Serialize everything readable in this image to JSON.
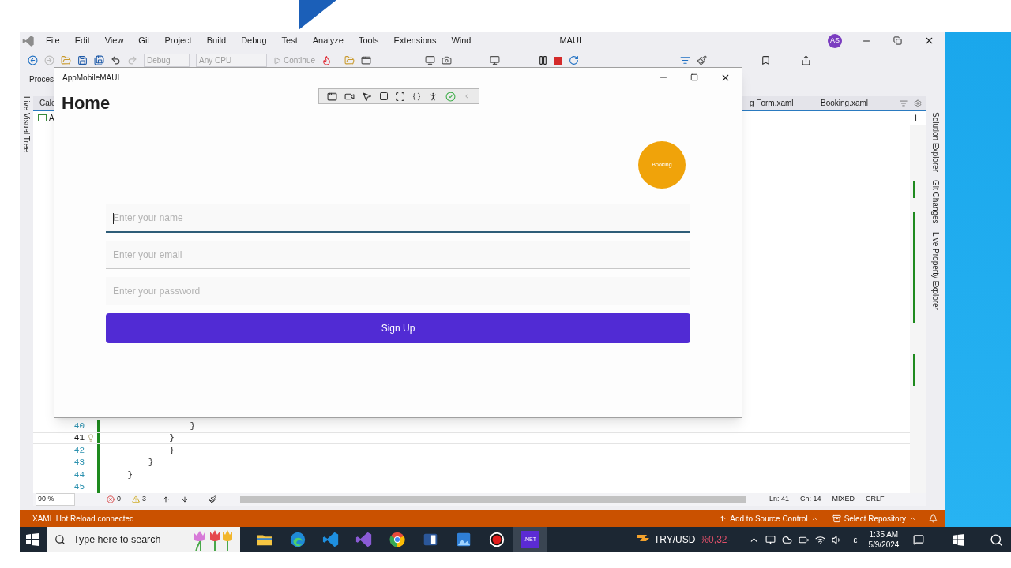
{
  "ide": {
    "menu": [
      "File",
      "Edit",
      "View",
      "Git",
      "Project",
      "Build",
      "Debug",
      "Test",
      "Analyze",
      "Tools",
      "Extensions",
      "Wind"
    ],
    "title_fragment": "MAUI",
    "account_initials": "AS",
    "toolbar": {
      "configuration": "Debug",
      "platform": "Any CPU",
      "run_label": "Continue"
    },
    "process_label": "Proces",
    "left_tool_tabs": [
      "Live Visual Tree"
    ],
    "doc_tab_fragment": "Cale",
    "nav_fragment": "A",
    "doc_tabs": [
      "g Form.xaml",
      "Booking.xaml"
    ],
    "code_lines": [
      {
        "number": "40",
        "text": "                }",
        "current": false,
        "lightbulb": false
      },
      {
        "number": "41",
        "text": "            }",
        "current": true,
        "lightbulb": true
      },
      {
        "number": "42",
        "text": "            }",
        "current": false,
        "lightbulb": false
      },
      {
        "number": "43",
        "text": "        }",
        "current": false,
        "lightbulb": false
      },
      {
        "number": "44",
        "text": "    }",
        "current": false,
        "lightbulb": false
      },
      {
        "number": "45",
        "current": false,
        "lightbulb": false
      }
    ],
    "editor_status": {
      "zoom": "90 %",
      "errors": "0",
      "warnings": "3",
      "line": "Ln: 41",
      "column": "Ch: 14",
      "whitespace": "MIXED",
      "line_ending": "CRLF"
    },
    "right_tool_tabs": [
      "Solution Explorer",
      "Git Changes",
      "Live Property Explorer"
    ],
    "status_bar": {
      "message": "XAML Hot Reload connected",
      "source_control": "Add to Source Control",
      "repository": "Select Repository"
    }
  },
  "app_window": {
    "title": "AppMobileMAUI",
    "heading": "Home",
    "booking_button": "Booking",
    "fields": [
      {
        "placeholder": "Enter your name",
        "focused": true
      },
      {
        "placeholder": "Enter your email",
        "focused": false
      },
      {
        "placeholder": "Enter your password",
        "focused": false
      }
    ],
    "submit_button": "Sign Up"
  },
  "taskbar": {
    "search_placeholder": "Type here to search",
    "apps": [
      {
        "kind": "folder",
        "selected": false
      },
      {
        "kind": "edge",
        "selected": false
      },
      {
        "kind": "vscode",
        "selected": false
      },
      {
        "kind": "visualstudio",
        "selected": false
      },
      {
        "kind": "chrome",
        "selected": false
      },
      {
        "kind": "word",
        "selected": false
      },
      {
        "kind": "photos",
        "selected": false
      },
      {
        "kind": "recorder",
        "selected": false
      },
      {
        "kind": "dotnet",
        "selected": true,
        "label": ".NET"
      }
    ],
    "ticker": "TRY/USD",
    "ticker_change": "%0,32-",
    "input_indicator": "ε",
    "time": "1:35 AM",
    "date": "5/9/2024"
  }
}
